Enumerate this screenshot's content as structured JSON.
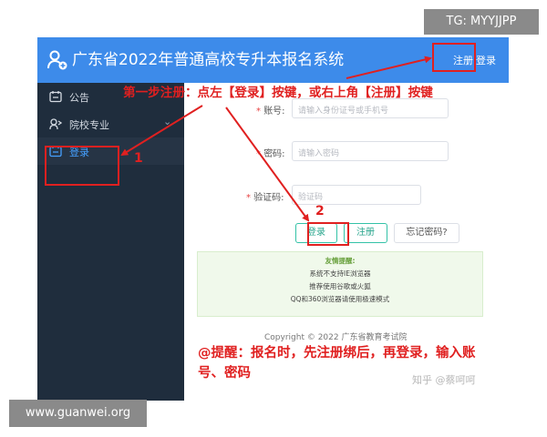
{
  "header": {
    "title": "广东省2022年普通高校专升本报名系统",
    "register_link": "注册",
    "login_link": "登录",
    "bar_color": "#3d8bea",
    "logo_icon": "user-plus-icon"
  },
  "sidebar": {
    "items": [
      {
        "label": "公告",
        "icon": "notice-icon"
      },
      {
        "label": "院校专业",
        "icon": "school-icon",
        "chevron": "⌄"
      },
      {
        "label": "登录",
        "icon": "login-icon",
        "active": true
      }
    ]
  },
  "form": {
    "account_label": "账号:",
    "account_placeholder": "请输入身份证号或手机号",
    "password_label": "密码:",
    "password_placeholder": "请输入密码",
    "captcha_label": "验证码:",
    "captcha_placeholder": "验证码",
    "required_mark": "*",
    "buttons": {
      "login": "登录",
      "register": "注册",
      "forgot": "忘记密码?"
    }
  },
  "tip": {
    "title": "友情提醒:",
    "lines": [
      "系统不支持IE浏览器",
      "推荐使用谷歌或火狐",
      "QQ和360浏览器请使用极速模式"
    ]
  },
  "footer": {
    "copyright": "Copyright © 2022 广东省教育考试院"
  },
  "annotations": {
    "step1": "第一步注册：点左【登录】按键，或右上角【注册】按键",
    "num1": "1",
    "num2": "2",
    "reminder_line1": "@提醒：报名时，先注册绑后，再登录，输入账",
    "reminder_line2": "号、密码",
    "color": "#e02020"
  },
  "watermarks": {
    "tg": "TG: MYYJJPP",
    "site": "www.guanwei.org",
    "zhihu": "知乎 @蔡呵呵"
  }
}
